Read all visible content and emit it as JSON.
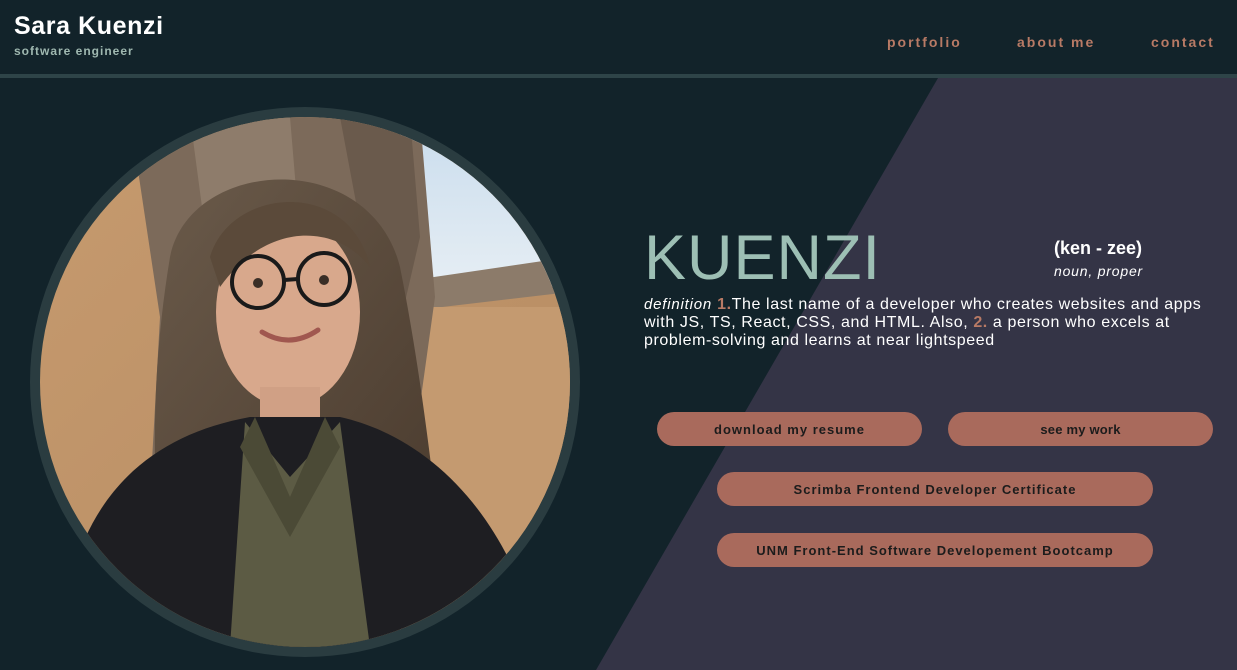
{
  "header": {
    "name": "Sara Kuenzi",
    "role": "software engineer",
    "nav": {
      "portfolio": "portfolio",
      "about": "about me",
      "contact": "contact"
    }
  },
  "hero": {
    "word": "KUENZI",
    "pronunciation": "(ken - zee)",
    "part_of_speech": "noun, proper",
    "definition_label": "definition",
    "num1": "1.",
    "def1": "The last name of a developer who creates websites and apps with JS, TS, React, CSS, and HTML. Also,",
    "num2": "2.",
    "def2": "a person who excels at problem-solving and learns at near lightspeed"
  },
  "buttons": {
    "resume": "download my resume",
    "work": "see my work",
    "scrimba": "Scrimba Frontend Developer Certificate",
    "unm": "UNM Front-End Software Developement Bootcamp"
  },
  "colors": {
    "background": "#12232a",
    "diagonal_panel": "#343446",
    "accent": "#b87a65",
    "button": "#a96a5c",
    "title": "#9dbfb4"
  },
  "icons": {
    "photo": "profile-photo"
  }
}
